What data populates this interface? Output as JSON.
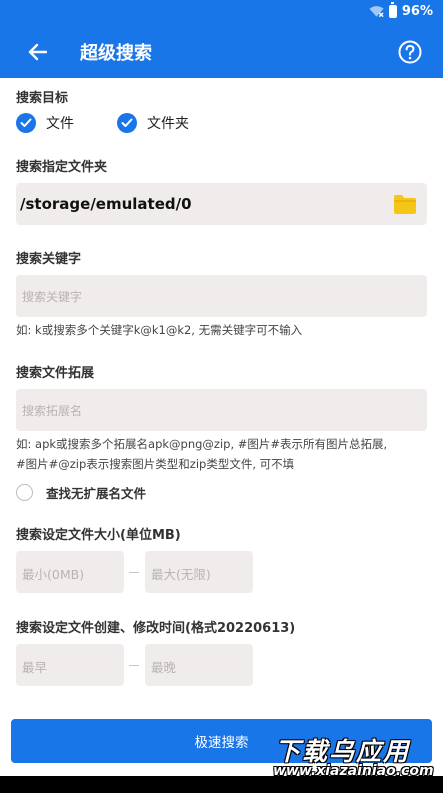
{
  "status_bar": {
    "battery": "96%"
  },
  "app_bar": {
    "title": "超级搜索"
  },
  "search_target": {
    "label": "搜索目标",
    "options": [
      {
        "label": "文件",
        "checked": true
      },
      {
        "label": "文件夹",
        "checked": true
      }
    ]
  },
  "folder": {
    "label": "搜索指定文件夹",
    "path": "/storage/emulated/0"
  },
  "keyword": {
    "label": "搜索关键字",
    "placeholder": "搜索关键字",
    "hint": "如: k或搜索多个关键字k@k1@k2, 无需关键字可不输入"
  },
  "extension": {
    "label": "搜索文件拓展",
    "placeholder": "搜索拓展名",
    "hint_line1": "如: apk或搜索多个拓展名apk@png@zip, #图片#表示所有图片总拓展,",
    "hint_line2": "#图片#@zip表示搜索图片类型和zip类型文件, 可不填",
    "no_ext_label": "查找无扩展名文件",
    "no_ext_checked": false
  },
  "size": {
    "label": "搜索设定文件大小(单位MB)",
    "min_placeholder": "最小(0MB)",
    "max_placeholder": "最大(无限)"
  },
  "time": {
    "label": "搜索设定文件创建、修改时间(格式20220613)",
    "earliest_placeholder": "最早",
    "latest_placeholder": "最晚"
  },
  "action": {
    "search_label": "极速搜索"
  },
  "watermark": {
    "title": "下载乌应用",
    "url": "www.xiazainiao.com"
  },
  "colors": {
    "primary": "#1976e8",
    "field_bg": "#efeceb",
    "folder_yellow": "#f5c517"
  },
  "icons": [
    "wifi-icon",
    "battery-icon",
    "back-arrow-icon",
    "help-icon",
    "check-icon",
    "folder-icon",
    "radio-icon"
  ]
}
